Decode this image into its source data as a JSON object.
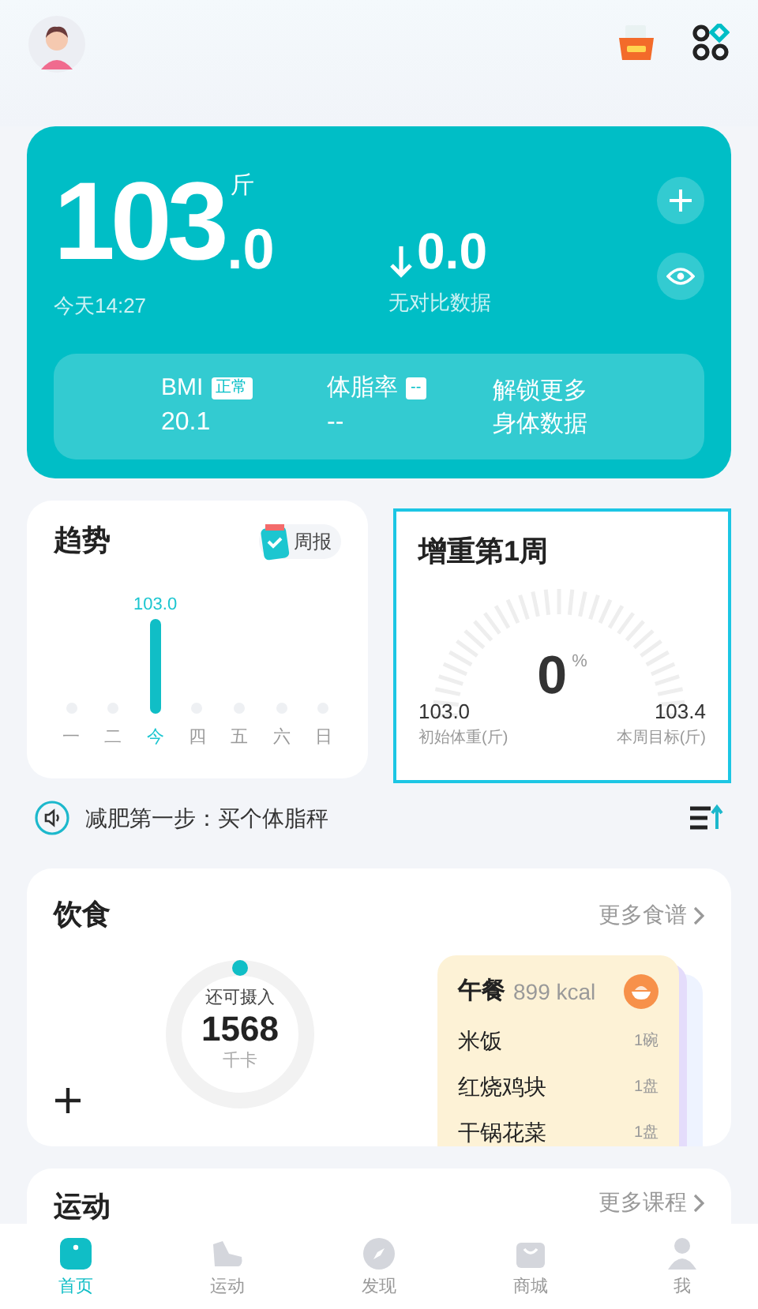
{
  "weight_card": {
    "value": "103",
    "decimal": ".0",
    "unit": "斤",
    "time": "今天14:27",
    "change": "0.0",
    "change_note": "无对比数据",
    "metrics": [
      {
        "kind": "metric",
        "label": "BMI",
        "tag": "正常",
        "value": "20.1"
      },
      {
        "kind": "metric",
        "label": "体脂率",
        "tag": "--",
        "value": "--"
      },
      {
        "kind": "unlock",
        "label": "解锁更多身体数据"
      }
    ]
  },
  "trend_card": {
    "title": "趋势",
    "report_button": "周报",
    "selected": false,
    "days": [
      {
        "label": "一",
        "selected": false
      },
      {
        "label": "二",
        "selected": false
      },
      {
        "label": "今",
        "selected": true,
        "value": "103.0"
      },
      {
        "label": "四",
        "selected": false
      },
      {
        "label": "五",
        "selected": false
      },
      {
        "label": "六",
        "selected": false
      },
      {
        "label": "日",
        "selected": false
      }
    ]
  },
  "gain_card": {
    "title": "增重第1周",
    "selected": true,
    "percent": "0",
    "percent_unit": "%",
    "start": {
      "value": "103.0",
      "label": "初始体重(斤)"
    },
    "target": {
      "value": "103.4",
      "label": "本周目标(斤)"
    }
  },
  "tip": {
    "text": "减肥第一步：买个体脂秤"
  },
  "diet_card": {
    "title": "饮食",
    "more_link": "更多食谱",
    "remaining": {
      "label": "还可摄入",
      "value": "1568",
      "unit": "千卡"
    },
    "meal": {
      "name": "午餐",
      "calories": "899 kcal",
      "items": [
        {
          "name": "米饭",
          "amount": "1碗"
        },
        {
          "name": "红烧鸡块",
          "amount": "1盘"
        },
        {
          "name": "干锅花菜",
          "amount": "1盘"
        }
      ]
    }
  },
  "exercise_card": {
    "title": "运动",
    "more_link": "更多课程"
  },
  "tab_bar": [
    {
      "label": "首页",
      "selected": true
    },
    {
      "label": "运动",
      "selected": false
    },
    {
      "label": "发现",
      "selected": false
    },
    {
      "label": "商城",
      "selected": false
    },
    {
      "label": "我",
      "selected": false
    }
  ]
}
